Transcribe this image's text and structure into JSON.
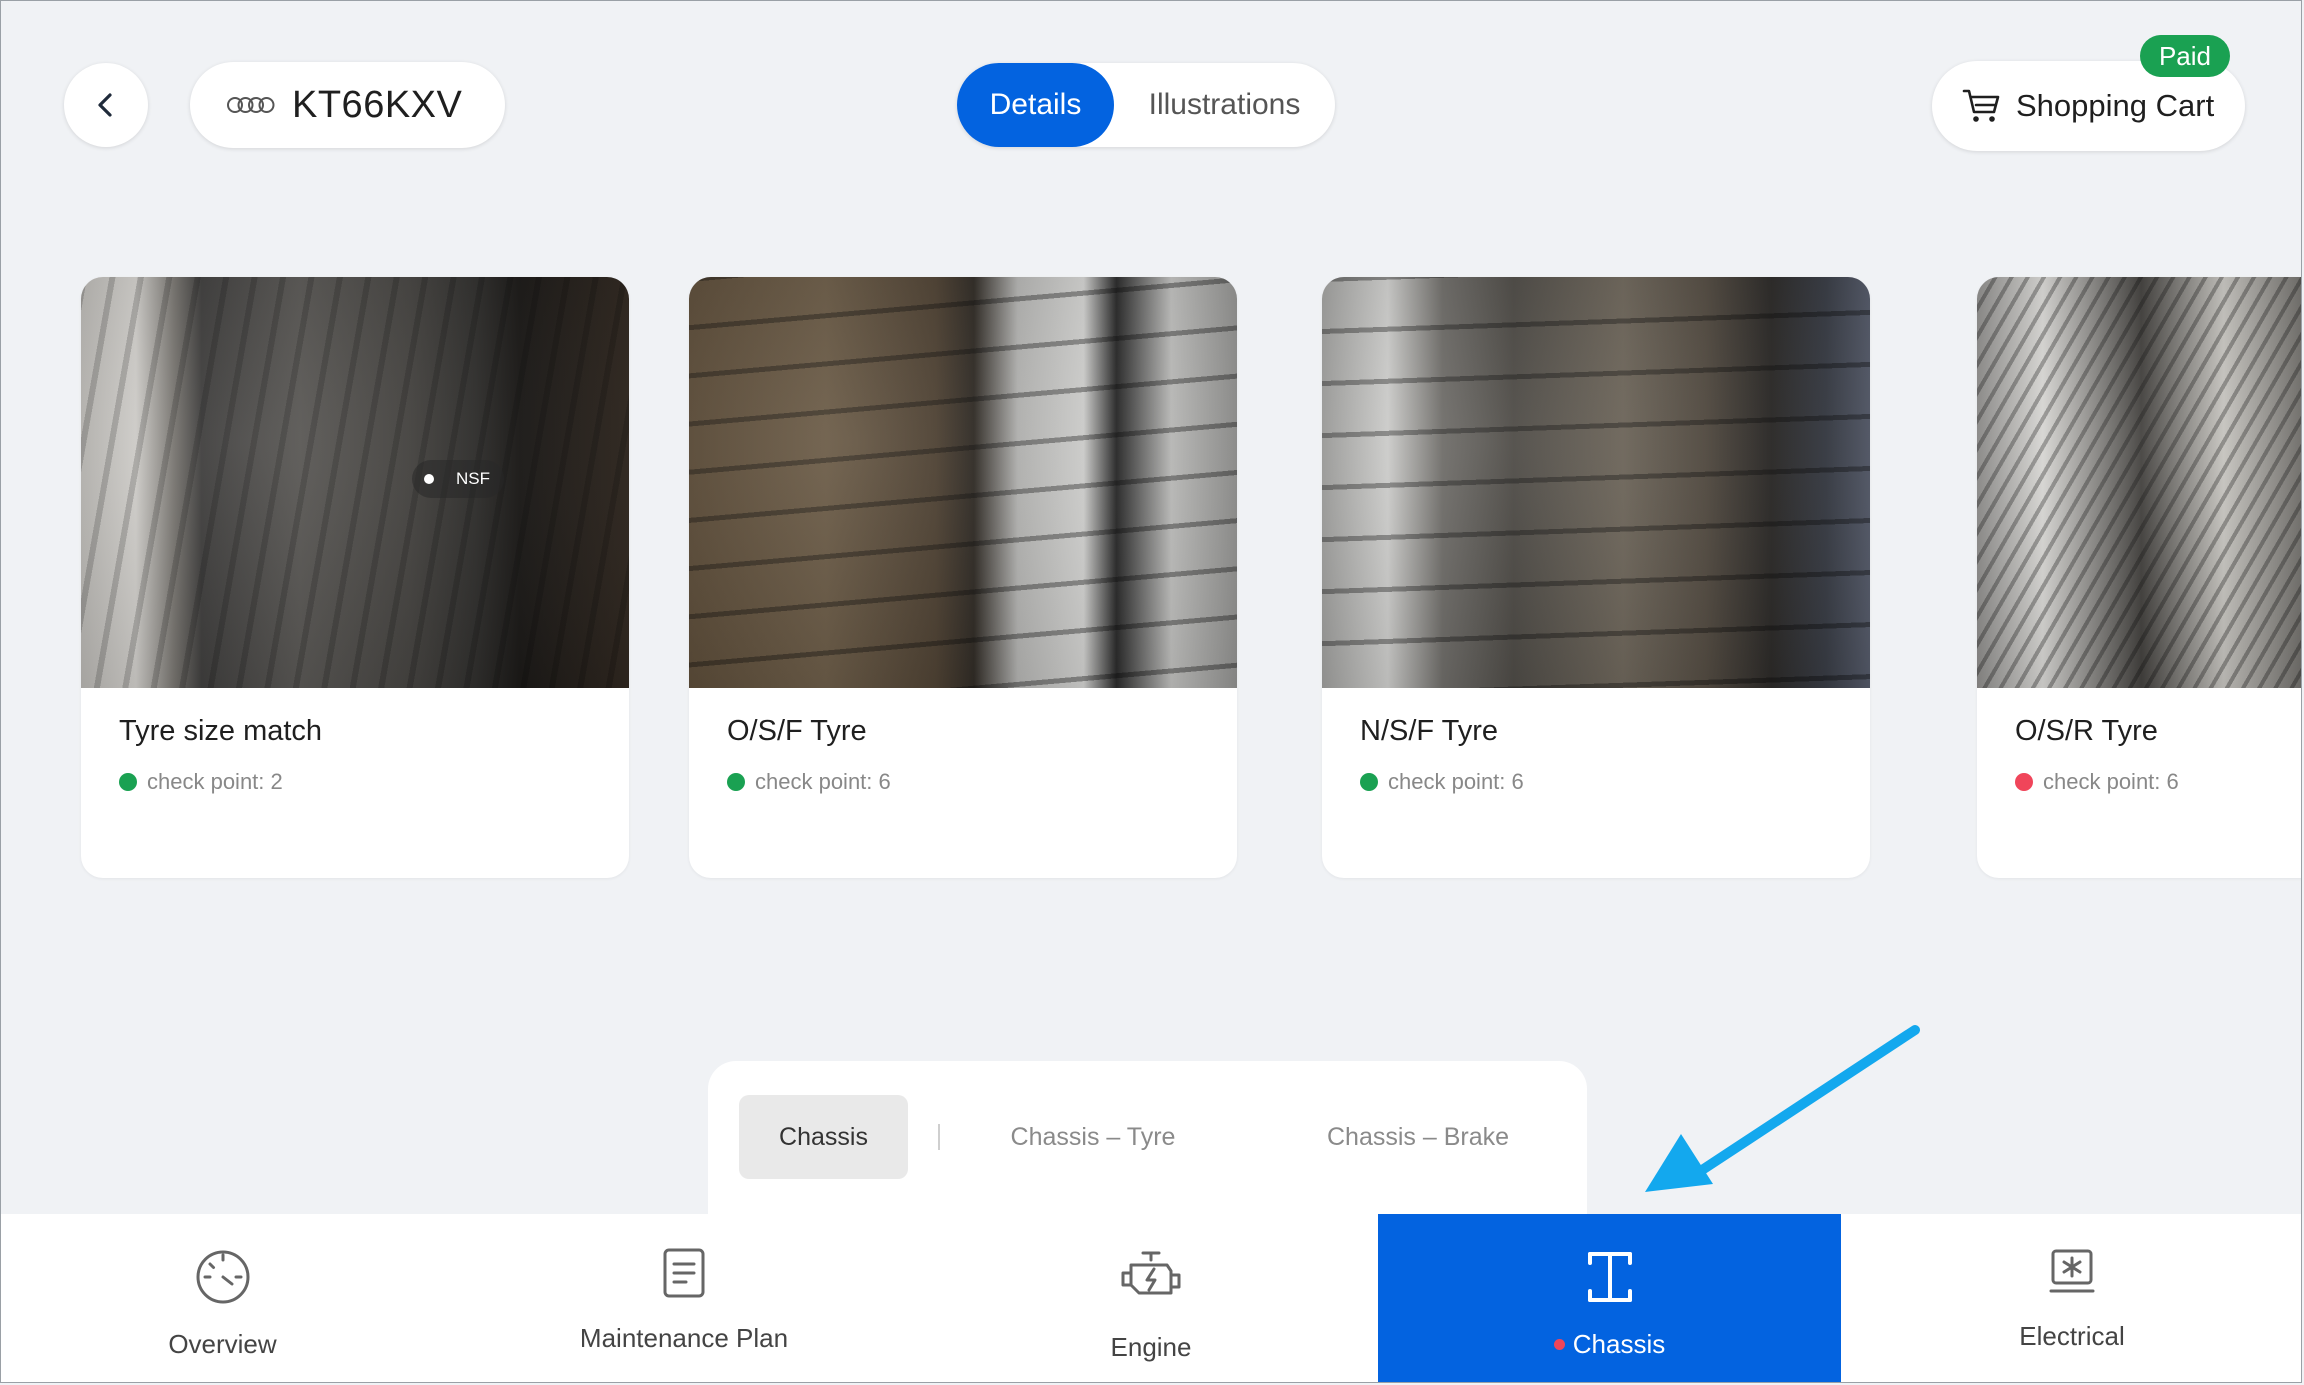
{
  "header": {
    "plate_number": "KT66KXV",
    "tabs": [
      {
        "label": "Details",
        "active": true
      },
      {
        "label": "Illustrations",
        "active": false
      }
    ],
    "cart_label": "Shopping Cart",
    "paid_badge": "Paid"
  },
  "cards": [
    {
      "title": "Tyre size match",
      "status_text": "check point: 2",
      "status_color": "#1aa152",
      "photo_tag": "NSF"
    },
    {
      "title": "O/S/F Tyre",
      "status_text": "check point: 6",
      "status_color": "#1aa152"
    },
    {
      "title": "N/S/F Tyre",
      "status_text": "check point: 6",
      "status_color": "#1aa152"
    },
    {
      "title": "O/S/R Tyre",
      "status_text": "check point: 6",
      "status_color": "#f0455a"
    }
  ],
  "subtabs": [
    {
      "label": "Chassis",
      "active": true
    },
    {
      "label": "Chassis – Tyre",
      "active": false
    },
    {
      "label": "Chassis – Brake",
      "active": false
    }
  ],
  "bottom_nav": [
    {
      "label": "Overview",
      "icon": "speedometer-icon",
      "active": false
    },
    {
      "label": "Maintenance Plan",
      "icon": "document-icon",
      "active": false
    },
    {
      "label": "Engine",
      "icon": "engine-icon",
      "active": false
    },
    {
      "label": "Chassis",
      "icon": "chassis-icon",
      "active": true,
      "alert_dot": true
    },
    {
      "label": "Electrical",
      "icon": "electrical-icon",
      "active": false
    }
  ],
  "colors": {
    "accent": "#0363e0",
    "status_ok": "#1aa152",
    "status_alert": "#f0455a",
    "annotation_arrow": "#13a8ee"
  }
}
